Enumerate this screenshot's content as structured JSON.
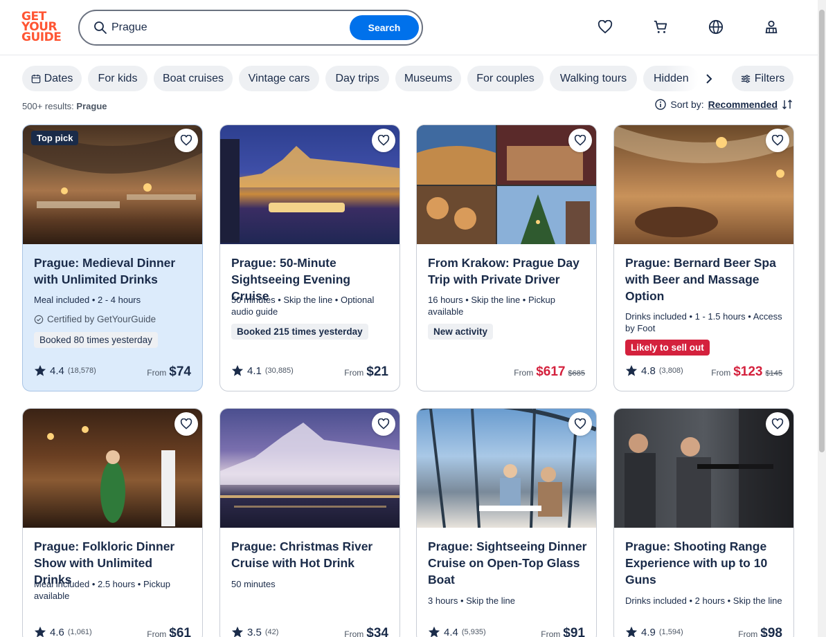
{
  "header": {
    "logo_lines": [
      "GET",
      "YOUR",
      "GUIDE"
    ],
    "search_value": "Prague",
    "search_button": "Search",
    "icons": [
      "heart-icon",
      "cart-icon",
      "globe-icon",
      "profile-icon"
    ]
  },
  "chips": {
    "items": [
      "Dates",
      "For kids",
      "Boat cruises",
      "Vintage cars",
      "Day trips",
      "Museums",
      "For couples",
      "Walking tours",
      "Hidden"
    ],
    "filters_label": "Filters"
  },
  "results": {
    "count": "500+ results:",
    "query": "Prague",
    "sort_label": "Sort by:",
    "sort_value": "Recommended"
  },
  "cards": [
    {
      "title": "Prague: Medieval Dinner with Unlimited Drinks",
      "badge": "Top pick",
      "meta": "Meal included • 2 - 4 hours",
      "certified": "Certified by GetYourGuide",
      "tag": "Booked 80 times yesterday",
      "rating": "4.4",
      "reviews": "(18,578)",
      "from": "From",
      "price": "$74"
    },
    {
      "title": "Prague: 50-Minute Sightseeing Evening Cruise",
      "meta": "50 minutes • Skip the line • Optional audio guide",
      "tag": "Booked 215 times yesterday",
      "rating": "4.1",
      "reviews": "(30,885)",
      "from": "From",
      "price": "$21"
    },
    {
      "title": "From Krakow: Prague Day Trip with Private Driver",
      "meta": "16 hours • Skip the line • Pickup available",
      "tag": "New activity",
      "from": "From",
      "price": "$617",
      "old_price": "$685"
    },
    {
      "title": "Prague: Bernard Beer Spa with Beer and Massage Option",
      "meta": "Drinks included • 1 - 1.5 hours • Access by Foot",
      "tag": "Likely to sell out",
      "rating": "4.8",
      "reviews": "(3,808)",
      "from": "From",
      "price": "$123",
      "old_price": "$145"
    },
    {
      "title": "Prague: Folkloric Dinner Show with Unlimited Drinks",
      "meta": "Meal included • 2.5 hours • Pickup available",
      "rating": "4.6",
      "reviews": "(1,061)",
      "from": "From",
      "price": "$61"
    },
    {
      "title": "Prague: Christmas River Cruise with Hot Drink",
      "meta": "50 minutes",
      "rating": "3.5",
      "reviews": "(42)",
      "from": "From",
      "price": "$34"
    },
    {
      "title": "Prague: Sightseeing Dinner Cruise on Open-Top Glass Boat",
      "meta": "3 hours • Skip the line",
      "rating": "4.4",
      "reviews": "(5,935)",
      "from": "From",
      "price": "$91"
    },
    {
      "title": "Prague: Shooting Range Experience with up to 10 Guns",
      "meta": "Drinks included • 2 hours • Skip the line",
      "rating": "4.9",
      "reviews": "(1,594)",
      "from": "From",
      "price": "$98"
    }
  ],
  "colors": {
    "brand": "#ff5533",
    "primary": "#0071eb",
    "text": "#1a2b49",
    "sale": "#d4213d",
    "highlight": "#dcebfb"
  }
}
